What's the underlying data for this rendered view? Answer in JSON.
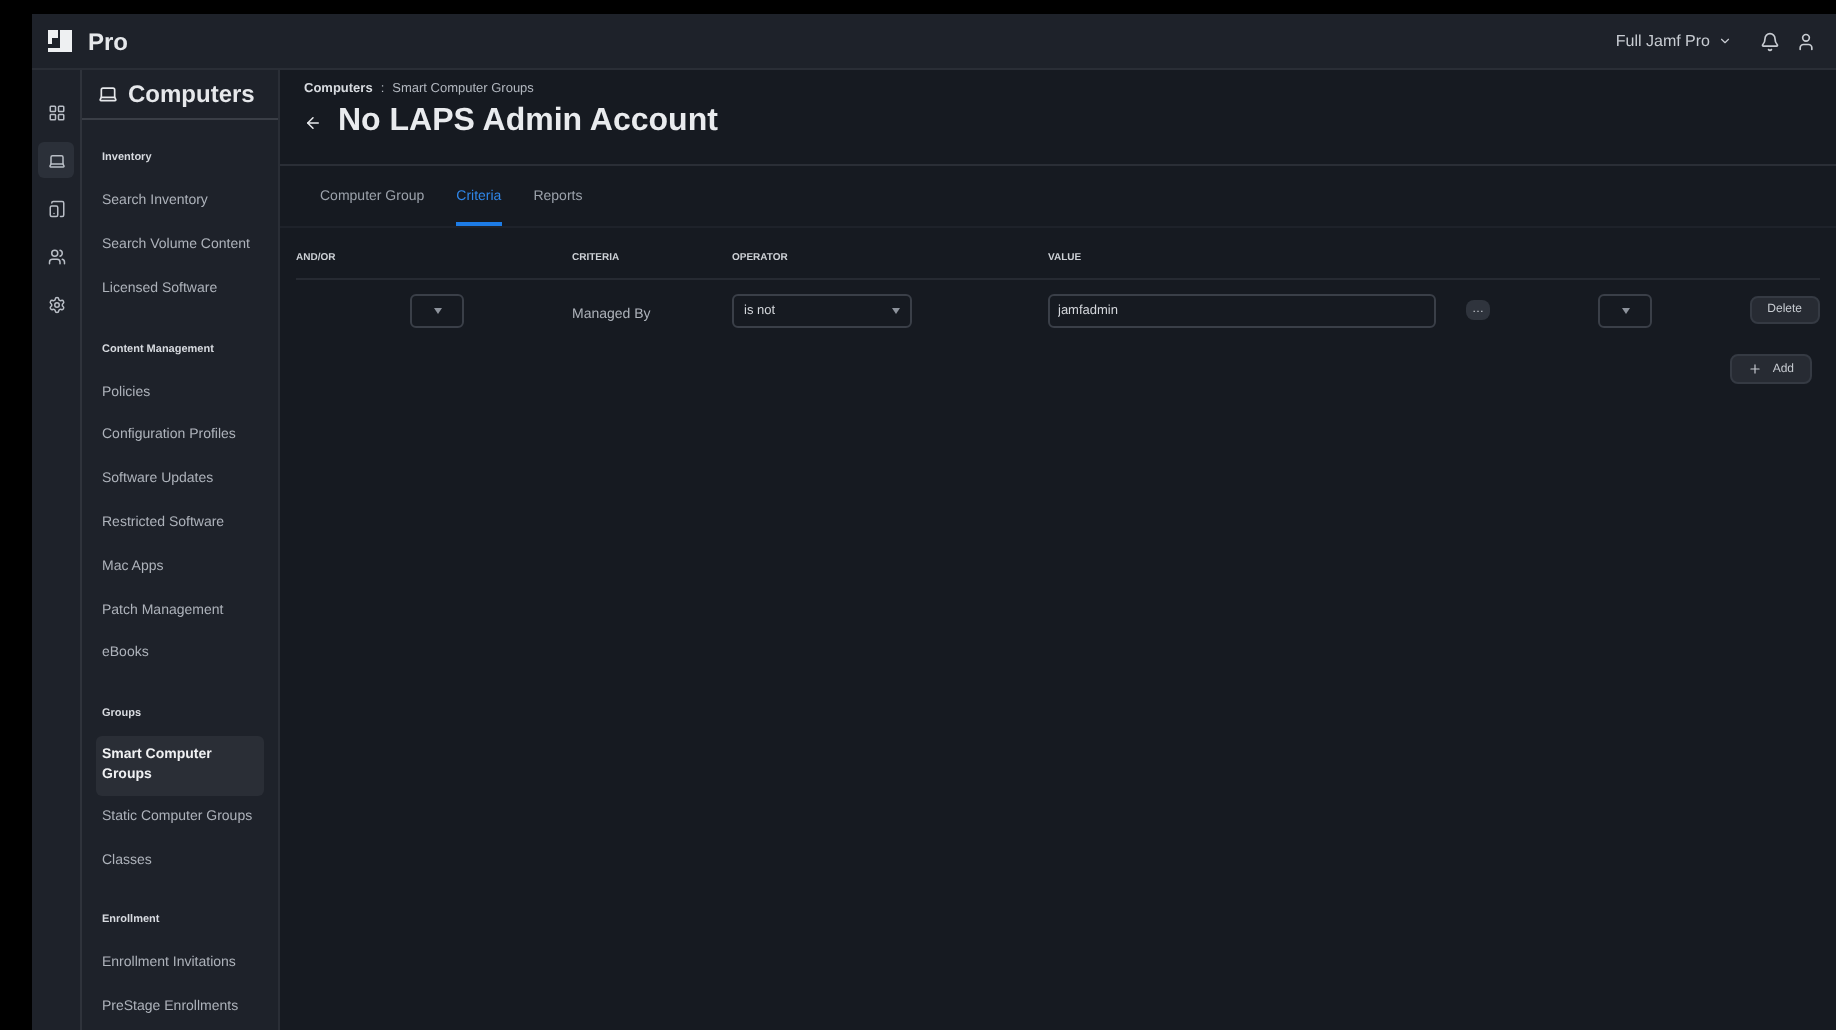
{
  "topbar": {
    "product": "Pro",
    "environment": "Full Jamf Pro"
  },
  "rail": [
    {
      "kind": "dashboard",
      "selected": false
    },
    {
      "kind": "computer",
      "selected": true
    },
    {
      "kind": "devices",
      "selected": false
    },
    {
      "kind": "users",
      "selected": false
    },
    {
      "kind": "settings",
      "selected": false
    }
  ],
  "sidebar": {
    "title": "Computers",
    "sections": [
      {
        "heading": "Inventory",
        "items": [
          {
            "label": "Search Inventory",
            "selected": false
          },
          {
            "label": "Search Volume Content",
            "selected": false
          },
          {
            "label": "Licensed Software",
            "selected": false
          }
        ]
      },
      {
        "heading": "Content Management",
        "items": [
          {
            "label": "Policies",
            "selected": false
          },
          {
            "label": "Configuration Profiles",
            "selected": false
          },
          {
            "label": "Software Updates",
            "selected": false
          },
          {
            "label": "Restricted Software",
            "selected": false
          },
          {
            "label": "Mac Apps",
            "selected": false
          },
          {
            "label": "Patch Management",
            "selected": false
          },
          {
            "label": "eBooks",
            "selected": false
          }
        ]
      },
      {
        "heading": "Groups",
        "items": [
          {
            "label": "Smart Computer Groups",
            "selected": true
          },
          {
            "label": "Static Computer Groups",
            "selected": false
          },
          {
            "label": "Classes",
            "selected": false
          }
        ]
      },
      {
        "heading": "Enrollment",
        "items": [
          {
            "label": "Enrollment Invitations",
            "selected": false
          },
          {
            "label": "PreStage Enrollments",
            "selected": false
          }
        ]
      }
    ]
  },
  "breadcrumb": {
    "root": "Computers",
    "separator": ":",
    "current": "Smart Computer Groups"
  },
  "title": "No LAPS Admin Account",
  "tabs": [
    {
      "label": "Computer Group",
      "selected": false
    },
    {
      "label": "Criteria",
      "selected": true
    },
    {
      "label": "Reports",
      "selected": false
    }
  ],
  "table": {
    "columns": [
      "AND/OR",
      "CRITERIA",
      "OPERATOR",
      "VALUE"
    ],
    "rows": [
      {
        "criteria": "Managed By",
        "operator": "is not",
        "value": "jamfadmin",
        "more": "…",
        "delete": "Delete"
      }
    ]
  },
  "add_button": "Add"
}
